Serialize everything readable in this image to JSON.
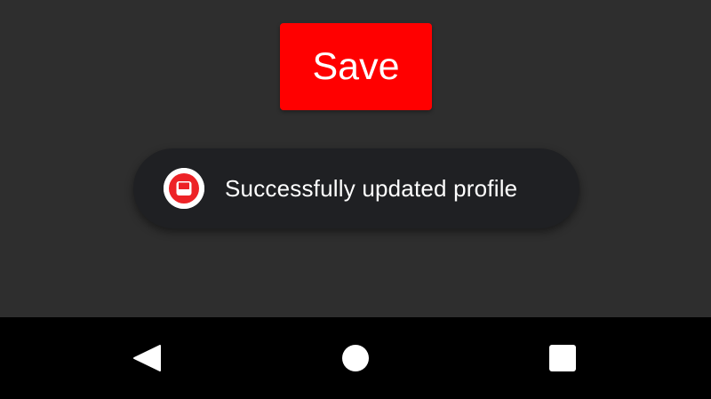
{
  "main": {
    "save_button": {
      "label": "Save",
      "color": "#ff0000"
    }
  },
  "toast": {
    "icon": "couchbase-logo-icon",
    "icon_color": "#ed2226",
    "message": "Successfully updated profile"
  },
  "navigation_bar": {
    "buttons": [
      {
        "icon": "back-triangle-icon"
      },
      {
        "icon": "home-circle-icon"
      },
      {
        "icon": "recents-square-icon"
      }
    ]
  }
}
